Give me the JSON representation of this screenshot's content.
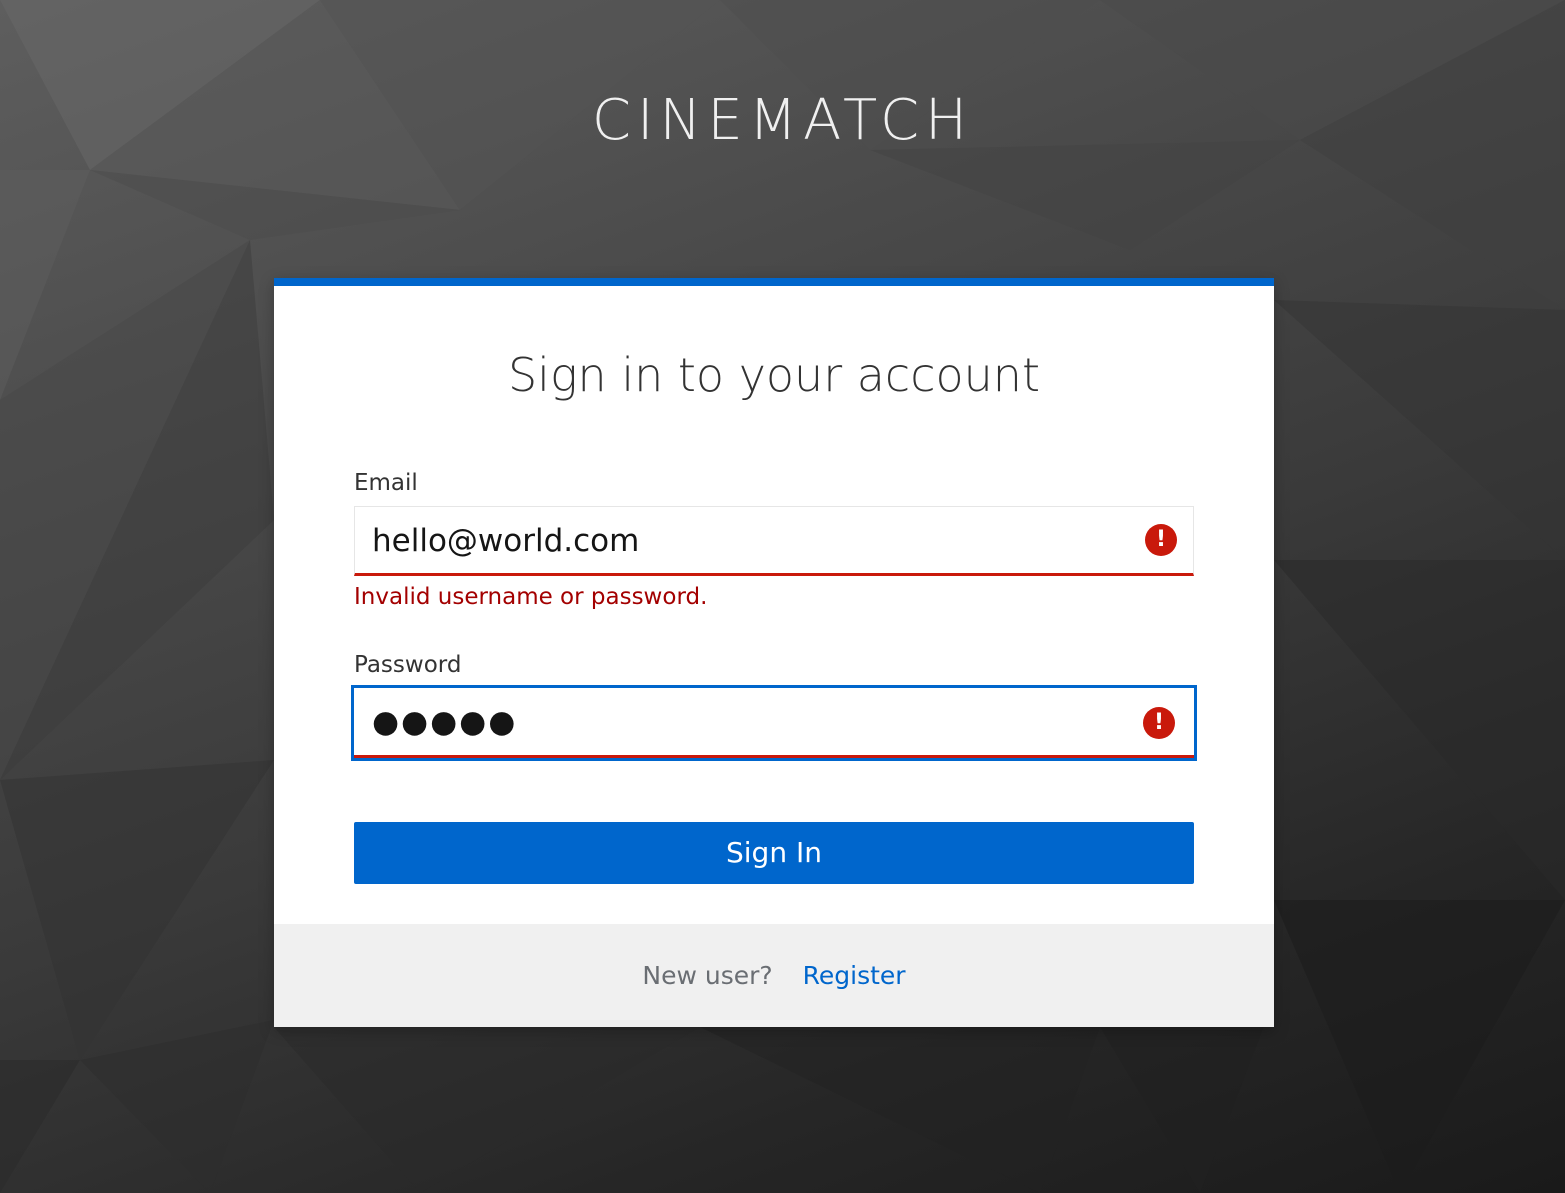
{
  "brand": {
    "title": "CINEMATCH"
  },
  "login_card": {
    "title": "Sign in to your account",
    "accent_color": "#0066cc",
    "email": {
      "label": "Email",
      "value": "hello@world.com",
      "error_icon": "exclamation-circle-icon"
    },
    "error_message": "Invalid username or password.",
    "password": {
      "label": "Password",
      "value": "●●●●●",
      "error_icon": "exclamation-circle-icon"
    },
    "sign_in_label": "Sign In",
    "footer": {
      "new_user_text": "New user?",
      "register_label": "Register"
    },
    "error_color": "#c9190b"
  }
}
